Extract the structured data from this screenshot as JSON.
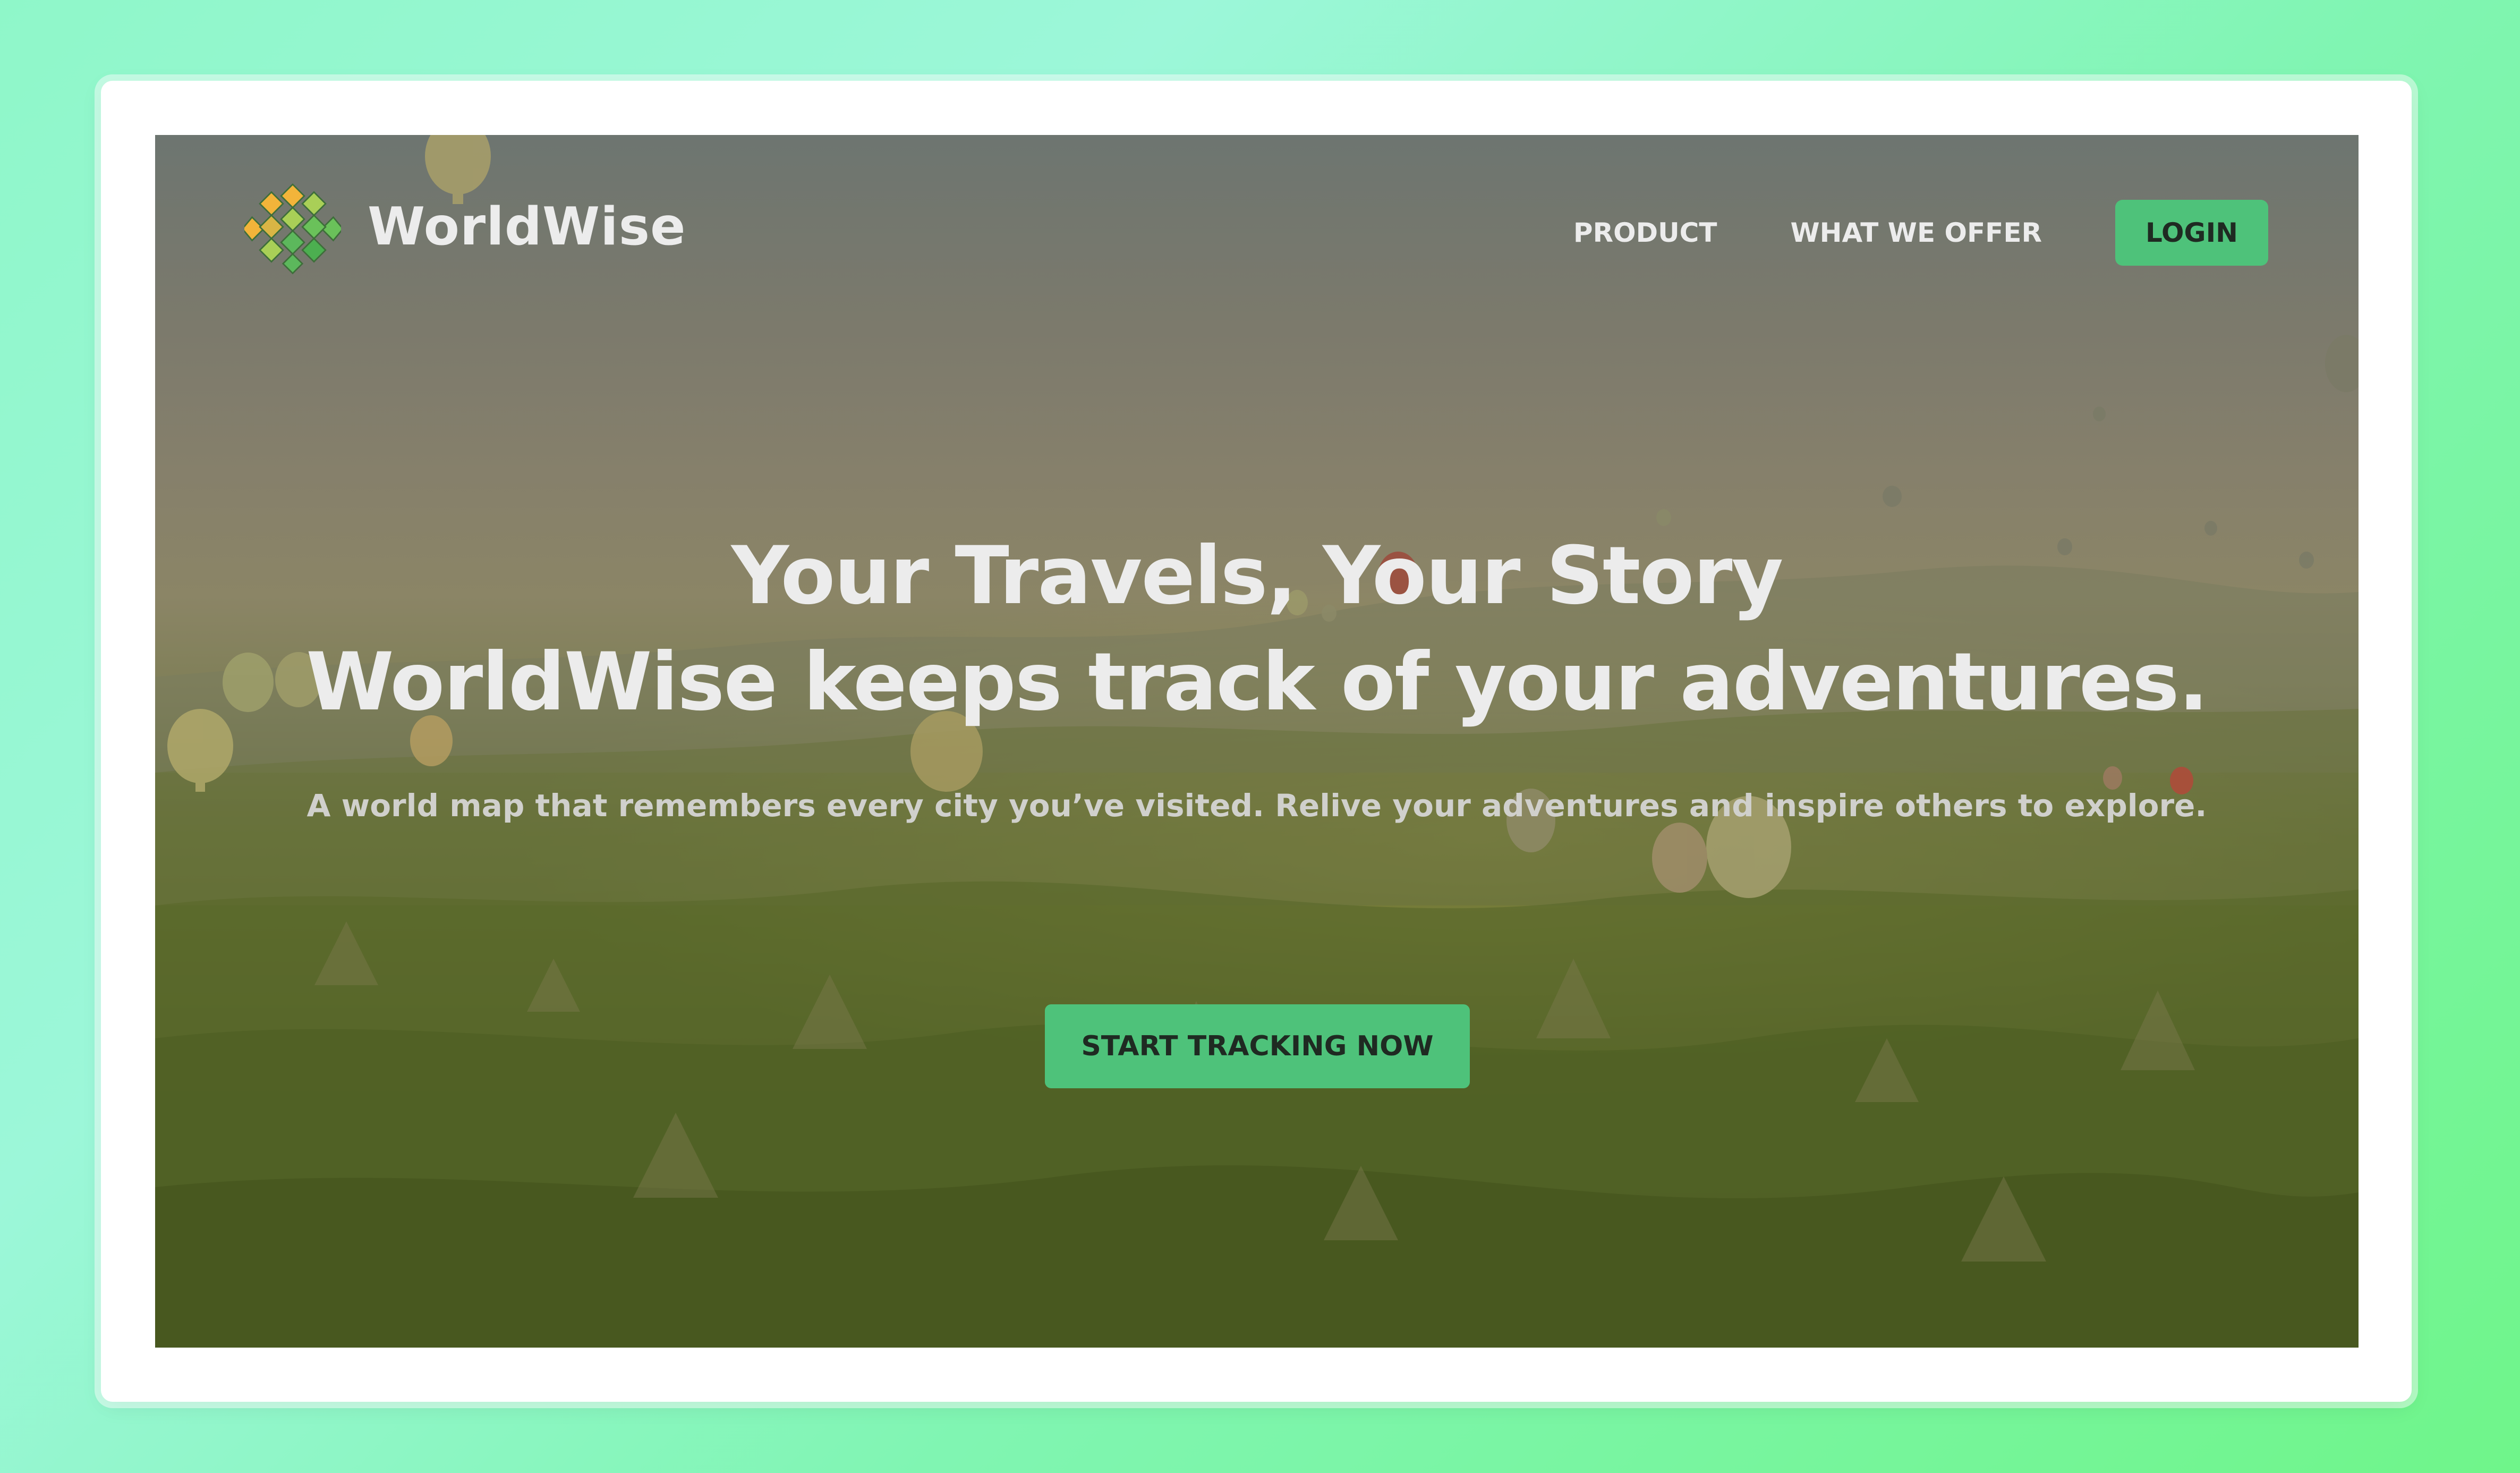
{
  "brand": {
    "name": "WorldWise",
    "logo_icon": "globe-lattice-icon",
    "accent_color": "#4ec27a"
  },
  "nav": {
    "links": [
      {
        "label": "PRODUCT"
      },
      {
        "label": "WHAT WE OFFER"
      }
    ],
    "login_label": "LOGIN"
  },
  "hero": {
    "headline_line1": "Your Travels, Your Story",
    "headline_line2": "WorldWise keeps track of your adventures.",
    "subtitle": "A world map that remembers every city you’ve visited. Relive your adventures and inspire others to explore.",
    "cta_label": "START TRACKING NOW",
    "background_image": "hot-air-balloons-over-valley"
  }
}
